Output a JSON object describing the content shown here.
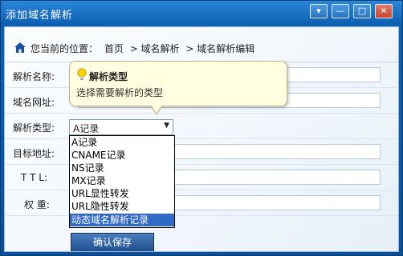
{
  "window": {
    "title": "添加域名解析",
    "controls": {
      "menu": "▾",
      "minimize": "—",
      "maximize": "□",
      "close": "✕"
    }
  },
  "breadcrumb": {
    "prefix": "您当前的位置：",
    "items": [
      "首页",
      "> 域名解析",
      "> 域名解析编辑"
    ]
  },
  "form": {
    "labels": {
      "record_name": "解析名称:",
      "domain": "域名网址:",
      "record_type": "解析类型:",
      "target": "目标地址:",
      "ttl": "T T L:",
      "weight": "权  重:"
    },
    "record_type_value": "A记录",
    "record_type_options": [
      "A记录",
      "CNAME记录",
      "NS记录",
      "MX记录",
      "URL显性转发",
      "URL隐性转发",
      "动态域名解析记录"
    ],
    "highlighted_option": "动态域名解析记录",
    "save_label": "确认保存"
  },
  "tooltip": {
    "title": "解析类型",
    "description": "选择需要解析的类型"
  },
  "colors": {
    "title_bar": "#1f78cc",
    "highlight": "#316ac5",
    "tooltip_bg": "#ffffe1"
  },
  "icons": {
    "home": "home-icon",
    "bulb": "lightbulb-icon",
    "dropdown": "chevron-down-icon"
  }
}
